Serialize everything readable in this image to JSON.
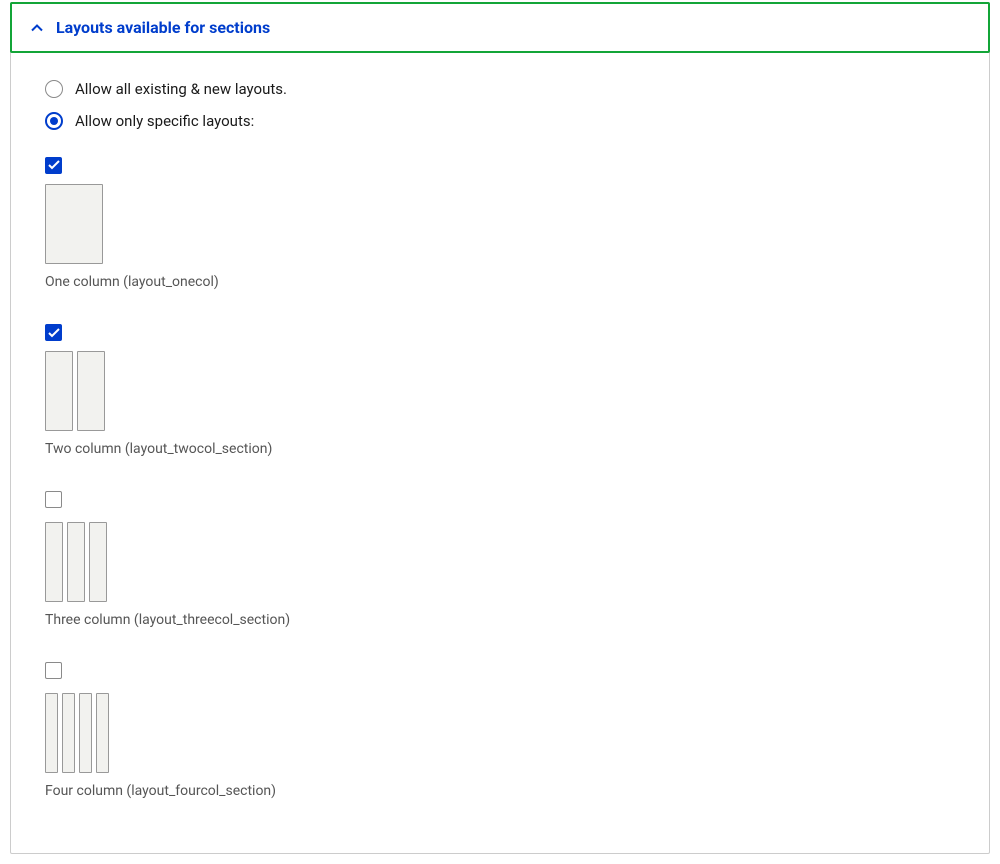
{
  "section": {
    "title": "Layouts available for sections"
  },
  "radios": {
    "allow_all": {
      "label": "Allow all existing & new layouts.",
      "selected": false
    },
    "allow_specific": {
      "label": "Allow only specific layouts:",
      "selected": true
    }
  },
  "layouts": [
    {
      "label": "One column (layout_onecol)",
      "checked": true,
      "cols": 1
    },
    {
      "label": "Two column (layout_twocol_section)",
      "checked": true,
      "cols": 2
    },
    {
      "label": "Three column (layout_threecol_section)",
      "checked": false,
      "cols": 3
    },
    {
      "label": "Four column (layout_fourcol_section)",
      "checked": false,
      "cols": 4
    }
  ]
}
